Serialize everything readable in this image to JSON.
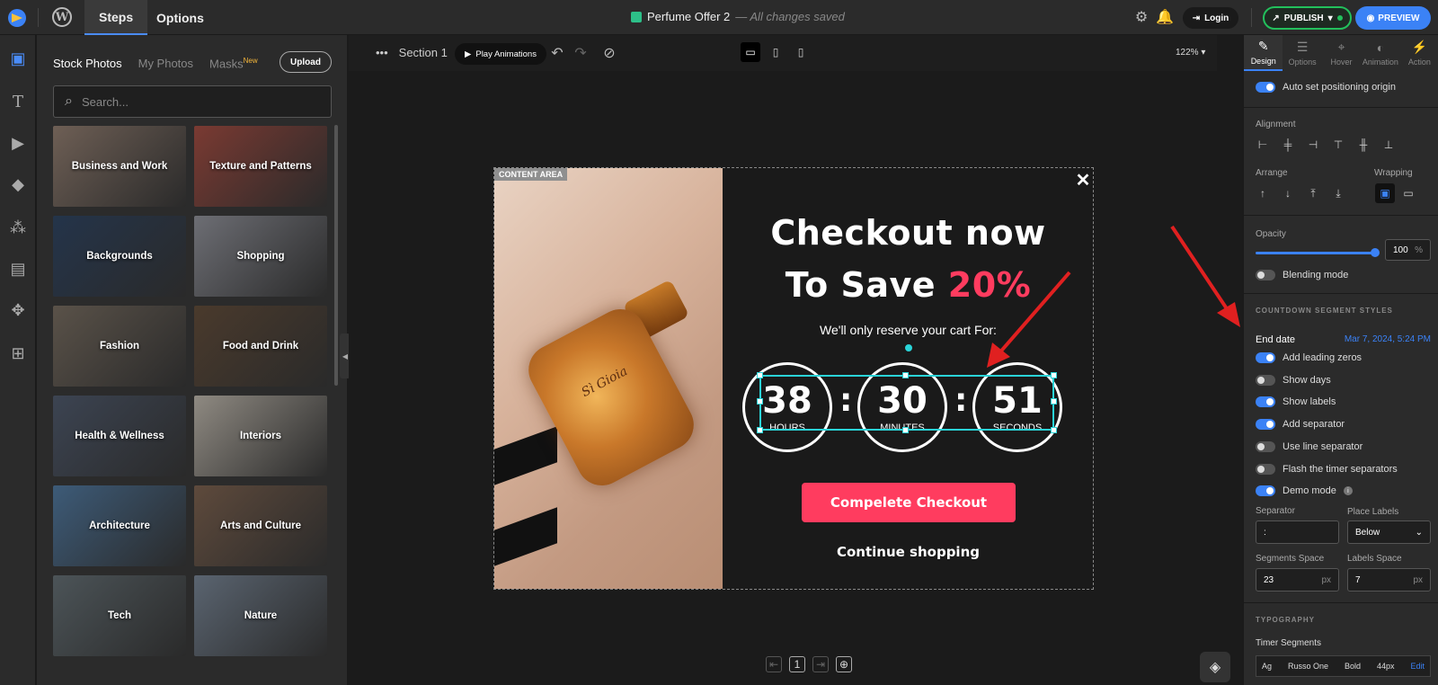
{
  "topbar": {
    "tabs": [
      "Steps",
      "Options"
    ],
    "doc_title": "Perfume Offer 2",
    "save_status": "— All changes saved",
    "login": "Login",
    "publish": "PUBLISH",
    "preview": "PREVIEW"
  },
  "left_panel": {
    "tabs": {
      "stock": "Stock Photos",
      "mine": "My Photos",
      "masks": "Masks",
      "new_badge": "New"
    },
    "upload": "Upload",
    "search_placeholder": "Search...",
    "tiles": [
      {
        "label": "Business and Work",
        "color": "#6e5f55"
      },
      {
        "label": "Texture and Patterns",
        "color": "#7a3a32"
      },
      {
        "label": "Backgrounds",
        "color": "#24344a"
      },
      {
        "label": "Shopping",
        "color": "#6d6e74"
      },
      {
        "label": "Fashion",
        "color": "#5a5249"
      },
      {
        "label": "Food and Drink",
        "color": "#4a3a2c"
      },
      {
        "label": "Health & Wellness",
        "color": "#3c4452"
      },
      {
        "label": "Interiors",
        "color": "#8f8a82"
      },
      {
        "label": "Architecture",
        "color": "#3d5b78"
      },
      {
        "label": "Arts and Culture",
        "color": "#5e4a3c"
      },
      {
        "label": "Tech",
        "color": "#4c5458"
      },
      {
        "label": "Nature",
        "color": "#5a6470"
      }
    ]
  },
  "canvas": {
    "section": "Section 1",
    "play": "Play Animations",
    "zoom": "122%",
    "content_area": "CONTENT AREA",
    "headline_1": "Checkout now",
    "headline_2a": "To Save ",
    "headline_2b": "20%",
    "reserve": "We'll only reserve your cart For:",
    "timer": {
      "hours": "38",
      "hours_label": "HOURS",
      "minutes": "30",
      "minutes_label": "MINUTES",
      "seconds": "51",
      "seconds_label": "SECONDS",
      "separator": ":"
    },
    "cta": "Compelete Checkout",
    "secondary": "Continue shopping",
    "bottle_text": "Sì Gioia",
    "page_number": "1"
  },
  "right_panel": {
    "tabs": [
      "Design",
      "Options",
      "Hover",
      "Animation",
      "Action"
    ],
    "auto_origin": "Auto set positioning origin",
    "alignment": "Alignment",
    "arrange": "Arrange",
    "wrapping": "Wrapping",
    "opacity": "Opacity",
    "opacity_value": "100",
    "opacity_unit": "%",
    "blending": "Blending mode",
    "countdown_heading": "COUNTDOWN SEGMENT STYLES",
    "end_date_label": "End date",
    "end_date_value": "Mar 7, 2024, 5:24 PM",
    "toggles": [
      {
        "label": "Add leading zeros",
        "on": true
      },
      {
        "label": "Show days",
        "on": false
      },
      {
        "label": "Show labels",
        "on": true
      },
      {
        "label": "Add separator",
        "on": true
      },
      {
        "label": "Use line separator",
        "on": false
      },
      {
        "label": "Flash the timer separators",
        "on": false
      },
      {
        "label": "Demo mode",
        "on": true
      }
    ],
    "separator_label": "Separator",
    "separator_value": ":",
    "place_labels_label": "Place Labels",
    "place_labels_value": "Below",
    "segments_space_label": "Segments Space",
    "segments_space_value": "23",
    "labels_space_label": "Labels Space",
    "labels_space_value": "7",
    "px": "px",
    "typography_heading": "TYPOGRAPHY",
    "timer_segments_label": "Timer Segments",
    "font_icon": "Ag",
    "font_family": "Russo One",
    "font_weight": "Bold",
    "font_size": "44px",
    "edit": "Edit"
  },
  "colors": {
    "accent": "#3b82f6",
    "cta": "#ff3c5f",
    "publish": "#22c05c",
    "selection": "#2ad4d8",
    "annotation": "#e02020"
  }
}
